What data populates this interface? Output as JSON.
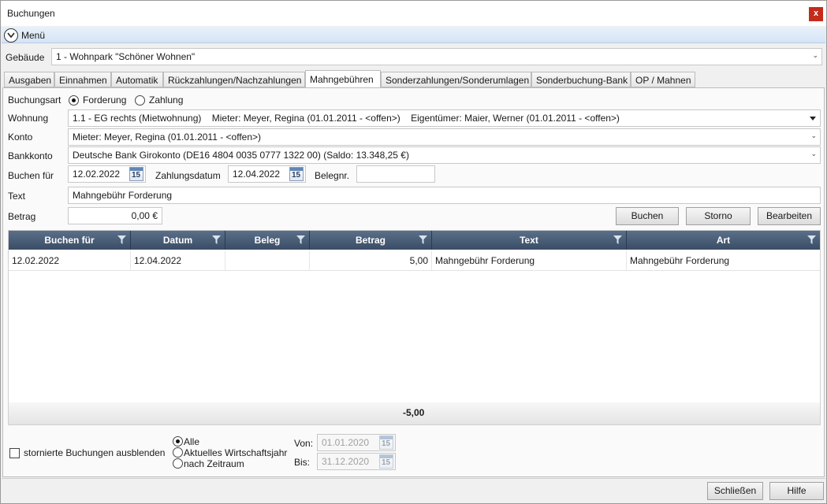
{
  "window": {
    "title": "Buchungen",
    "close_label": "x"
  },
  "menu": {
    "label": "Menü"
  },
  "building": {
    "label": "Gebäude",
    "value": "1 - Wohnpark \"Schöner Wohnen\""
  },
  "tabs": [
    {
      "label": "Ausgaben"
    },
    {
      "label": "Einnahmen"
    },
    {
      "label": "Automatik"
    },
    {
      "label": "Rückzahlungen/Nachzahlungen"
    },
    {
      "label": "Mahngebühren"
    },
    {
      "label": "Sonderzahlungen/Sonderumlagen"
    },
    {
      "label": "Sonderbuchung-Bank"
    },
    {
      "label": "OP / Mahnen"
    }
  ],
  "active_tab": "Mahngebühren",
  "form": {
    "booking_type_label": "Buchungsart",
    "booking_type_options": [
      "Forderung",
      "Zahlung"
    ],
    "booking_type_selected": "Forderung",
    "apartment_label": "Wohnung",
    "apartment_value": "1.1 - EG rechts (Mietwohnung)    Mieter: Meyer, Regina (01.01.2011 - <offen>)    Eigentümer: Maier, Werner (01.01.2011 - <offen>)",
    "account_label": "Konto",
    "account_value": "Mieter: Meyer, Regina (01.01.2011 - <offen>)",
    "bank_label": "Bankkonto",
    "bank_value": "Deutsche Bank Girokonto (DE16 4804 0035 0777 1322 00) (Saldo: 13.348,25 €)",
    "book_for_label": "Buchen für",
    "book_for_value": "12.02.2022",
    "payment_date_label": "Zahlungsdatum",
    "payment_date_value": "12.04.2022",
    "receipt_label": "Belegnr.",
    "receipt_value": "",
    "text_label": "Text",
    "text_value": "Mahngebühr Forderung",
    "amount_label": "Betrag",
    "amount_value": "0,00 €",
    "calendar_day": "15"
  },
  "actions": {
    "book": "Buchen",
    "cancel": "Storno",
    "edit": "Bearbeiten"
  },
  "table": {
    "columns": [
      "Buchen für",
      "Datum",
      "Beleg",
      "Betrag",
      "Text",
      "Art"
    ],
    "rows": [
      {
        "buchen_fuer": "12.02.2022",
        "datum": "12.04.2022",
        "beleg": "",
        "betrag": "5,00",
        "text": "Mahngebühr Forderung",
        "art": "Mahngebühr Forderung"
      }
    ],
    "sum": "-5,00"
  },
  "filter": {
    "hide_cancelled_label": "stornierte Buchungen ausblenden",
    "hide_cancelled_checked": false,
    "range_options": [
      "Alle",
      "Aktuelles Wirtschaftsjahr",
      "nach Zeitraum"
    ],
    "range_selected": "Alle",
    "from_label": "Von:",
    "from_value": "01.01.2020",
    "to_label": "Bis:",
    "to_value": "31.12.2020"
  },
  "footer": {
    "close": "Schließen",
    "help": "Hilfe"
  },
  "colors": {
    "header_dark": "#3b4d66",
    "close_red": "#c42b1c",
    "menubar": "#d5e4f5"
  }
}
